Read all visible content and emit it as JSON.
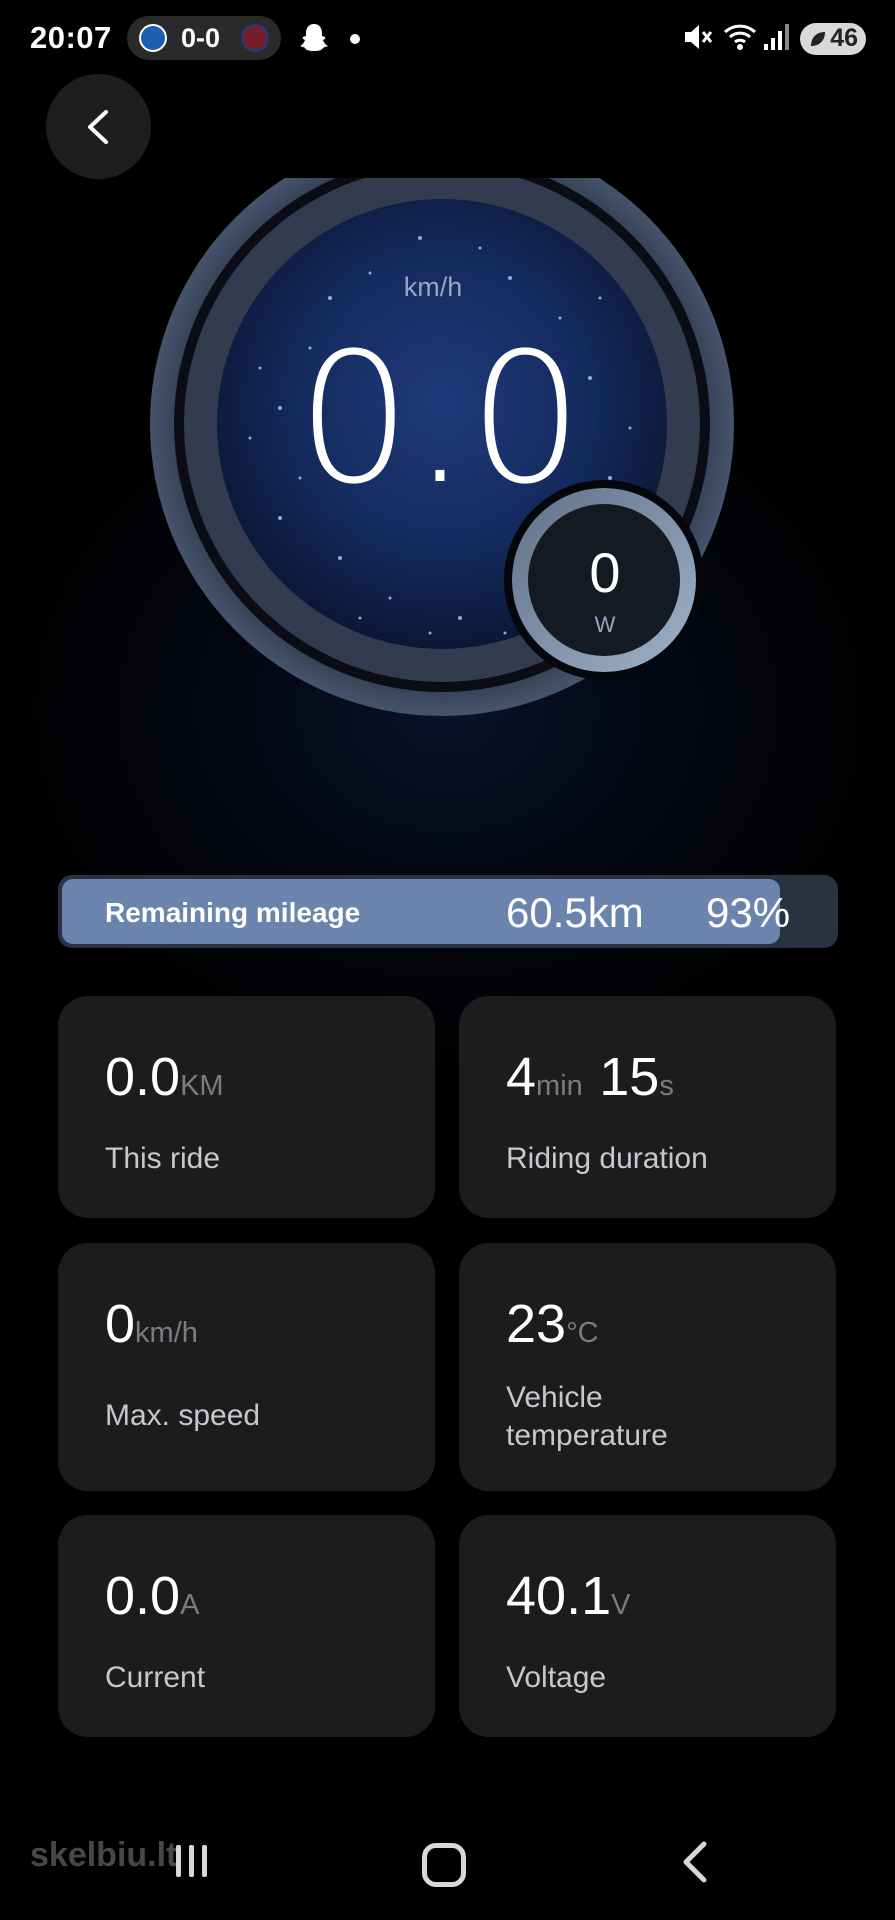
{
  "status_bar": {
    "time": "20:07",
    "score": "0-0",
    "battery": "46"
  },
  "gauge": {
    "speed_unit": "km/h",
    "speed_value": "0.0",
    "power_value": "0",
    "power_unit": "W"
  },
  "mileage": {
    "label": "Remaining mileage",
    "distance": "60.5km",
    "battery_percent": "93%",
    "fill_fraction": 0.93
  },
  "cards": [
    {
      "value": "0.0",
      "unit": "KM",
      "label": "This ride"
    },
    {
      "value": "4",
      "unit": "min",
      "value2": "15",
      "unit2": "s",
      "label": "Riding duration"
    },
    {
      "value": "0",
      "unit": "km/h",
      "label": "Max. speed"
    },
    {
      "value": "23",
      "unit": "°C",
      "label_line1": "Vehicle",
      "label_line2": "temperature"
    },
    {
      "value": "0.0",
      "unit": "A",
      "label": "Current"
    },
    {
      "value": "40.1",
      "unit": "V",
      "label": "Voltage"
    }
  ],
  "watermark": "skelbiu.lt",
  "colors": {
    "accent_fill": "#6b84ad",
    "card_bg": "#1c1c1e",
    "gauge_blue": "#1a2f66"
  }
}
